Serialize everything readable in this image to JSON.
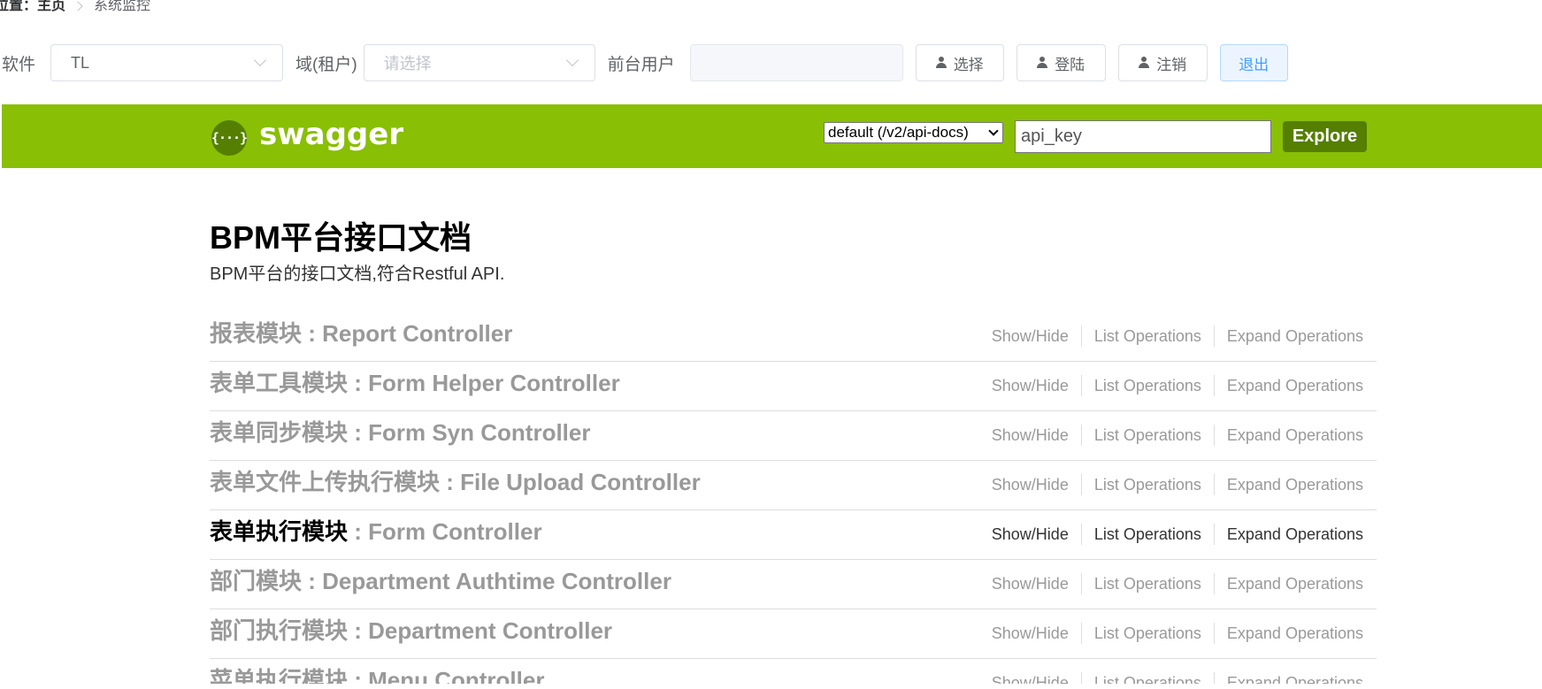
{
  "breadcrumb": {
    "prefix": "位置：",
    "home": "主页",
    "current": "系统监控"
  },
  "toolbar": {
    "software_label": "软件",
    "software_value": "TL",
    "domain_label": "域(租户)",
    "domain_placeholder": "请选择",
    "user_label": "前台用户",
    "user_value": "",
    "select_button": "选择",
    "login_button": "登陆",
    "logout_button": "注销",
    "exit_button": "退出"
  },
  "swagger": {
    "logo_glyph": "{···}",
    "logo_text": "swagger",
    "api_select_value": "default (/v2/api-docs)",
    "api_key_placeholder": "api_key",
    "explore_button": "Explore",
    "header_color": "#89bf04",
    "accent_color": "#547f00"
  },
  "doc": {
    "title": "BPM平台接口文档",
    "description": "BPM平台的接口文档,符合Restful API."
  },
  "ops_labels": {
    "show_hide": "Show/Hide",
    "list": "List Operations",
    "expand": "Expand Operations"
  },
  "resources": [
    {
      "name": "报表模块",
      "controller": " : Report Controller"
    },
    {
      "name": "表单工具模块",
      "controller": " : Form Helper Controller"
    },
    {
      "name": "表单同步模块",
      "controller": " : Form Syn Controller"
    },
    {
      "name": "表单文件上传执行模块",
      "controller": " : File Upload Controller"
    },
    {
      "name": "表单执行模块",
      "controller": " : Form Controller"
    },
    {
      "name": "部门模块",
      "controller": " : Department Authtime Controller"
    },
    {
      "name": "部门执行模块",
      "controller": " : Department Controller"
    },
    {
      "name": "菜单执行模块",
      "controller": " : Menu Controller"
    }
  ]
}
